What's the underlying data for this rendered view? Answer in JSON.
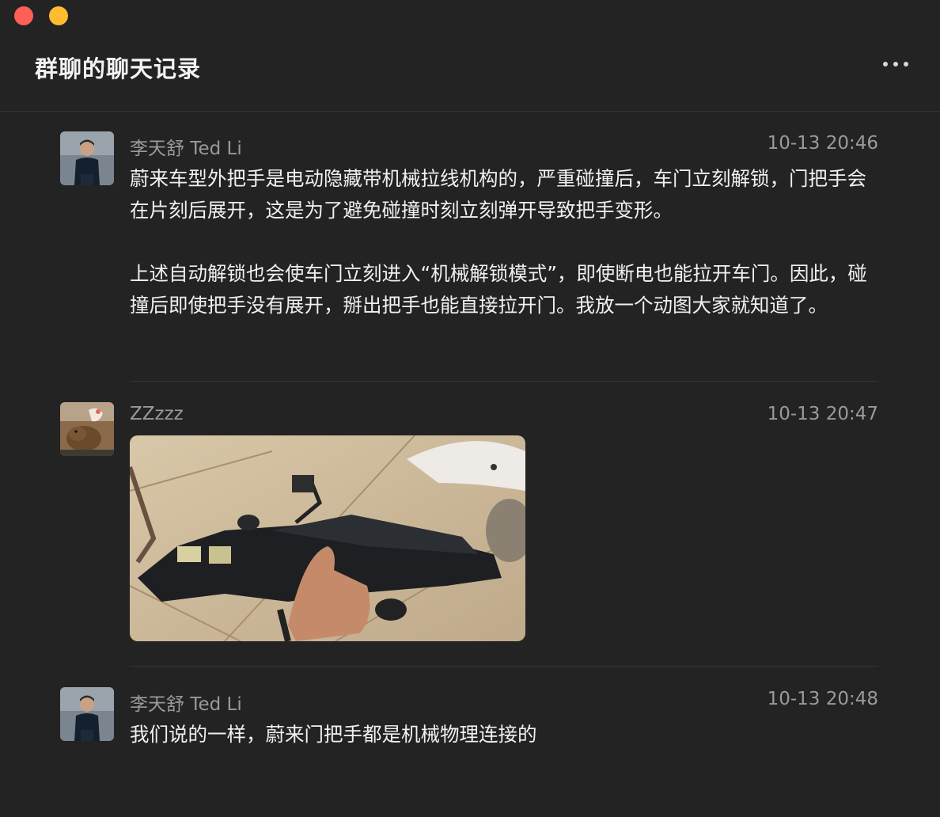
{
  "window": {
    "title": "群聊的聊天记录"
  },
  "messages": [
    {
      "sender": "李天舒 Ted Li",
      "time": "10-13 20:46",
      "paragraphs": [
        "蔚来车型外把手是电动隐藏带机械拉线机构的，严重碰撞后，车门立刻解锁，门把手会在片刻后展开，这是为了避免碰撞时刻立刻弹开导致把手变形。",
        "上述自动解锁也会使车门立刻进入“机械解锁模式”，即使断电也能拉开车门。因此，碰撞后即使把手没有展开，掰出把手也能直接拉开门。我放一个动图大家就知道了。"
      ]
    },
    {
      "sender": "ZZzzz",
      "time": "10-13 20:47",
      "image": "door-handle-mechanism-photo"
    },
    {
      "sender": "李天舒 Ted Li",
      "time": "10-13 20:48",
      "paragraphs": [
        "我们说的一样，蔚来门把手都是机械物理连接的"
      ]
    }
  ],
  "colors": {
    "background": "#232323",
    "text": "#f0f0f0",
    "meta": "#9a9a9a",
    "close": "#fe5f57",
    "minimize": "#febc2e"
  }
}
